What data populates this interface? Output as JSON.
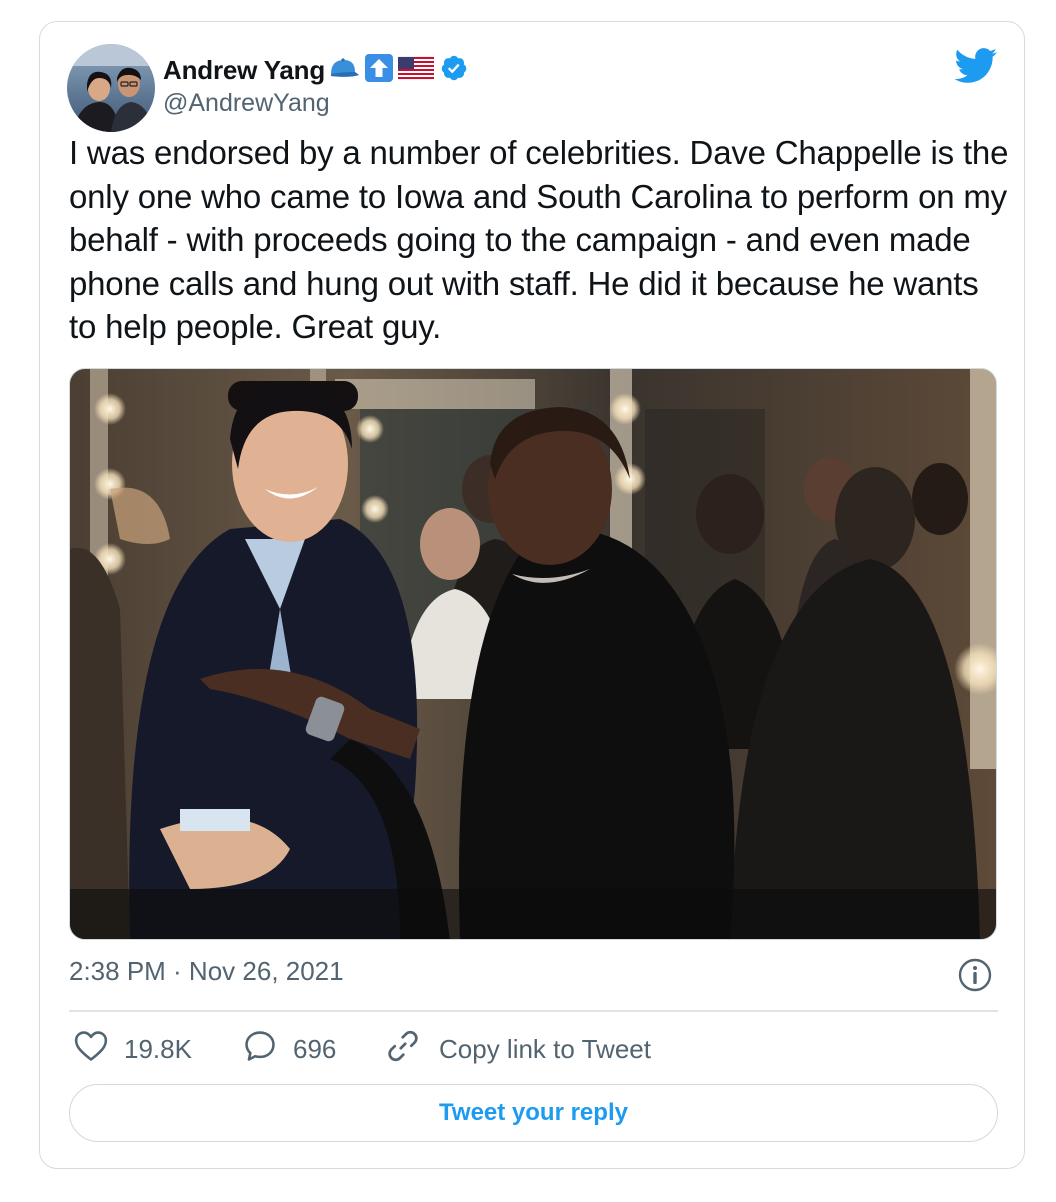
{
  "author": {
    "name": "Andrew Yang",
    "handle": "@AndrewYang",
    "name_emojis": [
      "blue-cap-icon",
      "up-arrow-icon",
      "us-flag-icon",
      "verified-badge-icon"
    ]
  },
  "tweet": {
    "text": "I was endorsed by a number of celebrities. Dave Chappelle is the only one who came to Iowa and South Carolina to perform on my behalf - with proceeds going to the campaign - and even made phone calls and hung out with staff. He did it because he wants to help people. Great guy.",
    "timestamp": "2:38 PM · Nov 26, 2021"
  },
  "actions": {
    "likes": "19.8K",
    "replies": "696",
    "copy_link": "Copy link to Tweet"
  },
  "reply_button": "Tweet your reply",
  "colors": {
    "accent": "#1d9bf0",
    "text": "#0f1419",
    "secondary": "#536471",
    "border": "#cfd9de"
  }
}
